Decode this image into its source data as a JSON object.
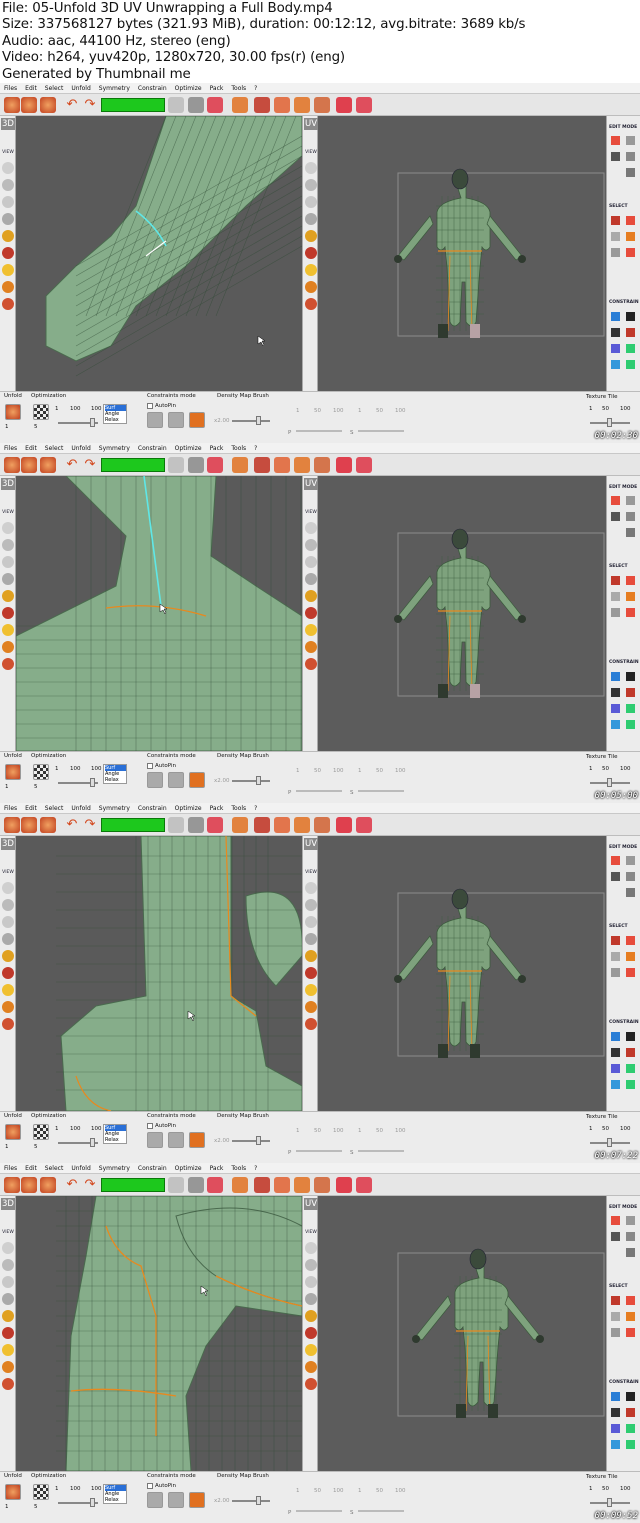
{
  "header": {
    "line1": "File: 05-Unfold 3D UV Unwrapping a Full Body.mp4",
    "line2": "Size: 337568127 bytes (321.93 MiB), duration: 00:12:12, avg.bitrate: 3689 kb/s",
    "line3": "Audio: aac, 44100 Hz, stereo (eng)",
    "line4": "Video: h264, yuv420p, 1280x720, 30.00 fps(r) (eng)",
    "line5": "Generated by Thumbnail me"
  },
  "menu": [
    "Files",
    "Edit",
    "Select",
    "Unfold",
    "Symmetry",
    "Constrain",
    "Optimize",
    "Pack",
    "Tools",
    "?"
  ],
  "panels": {
    "left_label": "3D",
    "mid_label": "UV",
    "view_label": "VIEW",
    "edit_mode": "EDIT MODE",
    "select": "SELECT",
    "constrain": "CONSTRAIN"
  },
  "bottom": {
    "unfold": "Unfold",
    "optimization": "Optimization",
    "constraints_mode": "Constraints mode",
    "density_brush": "Density Map Brush",
    "texture_tile": "Texture Tile",
    "autopin": "AutoPin",
    "n1": "1",
    "n100a": "100",
    "n100b": "100",
    "list": [
      "Surf",
      "Angle",
      "Relax"
    ],
    "step1": "1",
    "step5": "5",
    "x200": "x2.00",
    "p": "P",
    "s": "S",
    "ticks_p": [
      "1",
      "50",
      "100"
    ],
    "ticks_s": [
      "1",
      "50",
      "100"
    ],
    "tt1": "1",
    "tt50": "50",
    "tt100": "100"
  },
  "frames": [
    {
      "timestamp": "00:02:30"
    },
    {
      "timestamp": "00:05:00"
    },
    {
      "timestamp": "00:07:22"
    },
    {
      "timestamp": "00:09:52"
    }
  ],
  "colors": {
    "mesh": "#86ad8a",
    "viewport": "#5a5a5a",
    "seam_orange": "#e8891e",
    "seam_cyan": "#5fe7e7",
    "accent_green": "#1dc81d"
  }
}
